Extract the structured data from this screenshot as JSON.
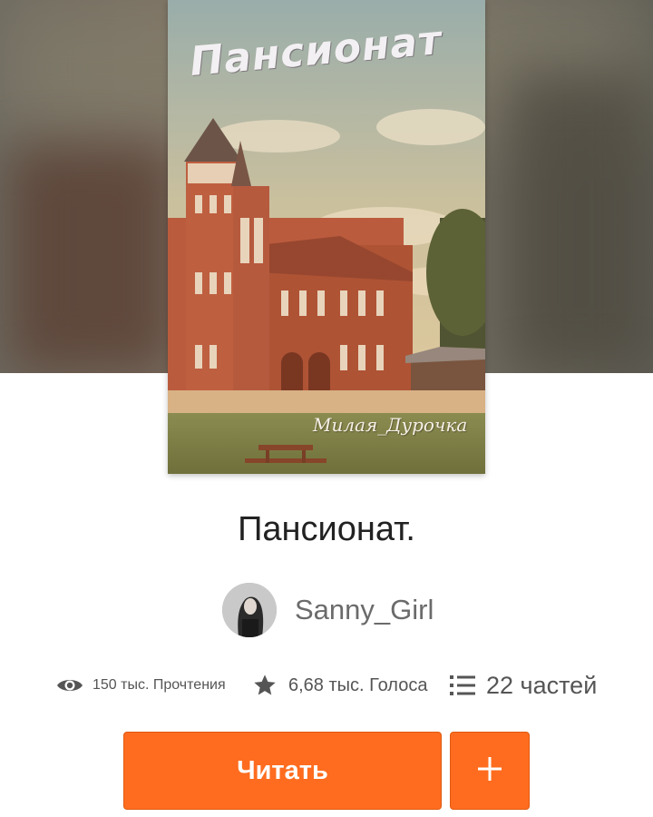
{
  "cover": {
    "title_art": "Пансионат",
    "watermark": "Милая_Дурочка"
  },
  "story": {
    "title": "Пансионат."
  },
  "author": {
    "name": "Sanny_Girl"
  },
  "stats": {
    "views": "150 тыс. Прочтения",
    "votes": "6,68 тыс. Голоса",
    "parts": "22 частей"
  },
  "actions": {
    "read_label": "Читать"
  },
  "colors": {
    "accent": "#ff6c1f",
    "title_text": "#222222",
    "secondary_text": "#6b6b6b"
  },
  "icons": {
    "views": "eye-icon",
    "votes": "star-icon",
    "parts": "list-icon",
    "add": "plus-icon"
  }
}
